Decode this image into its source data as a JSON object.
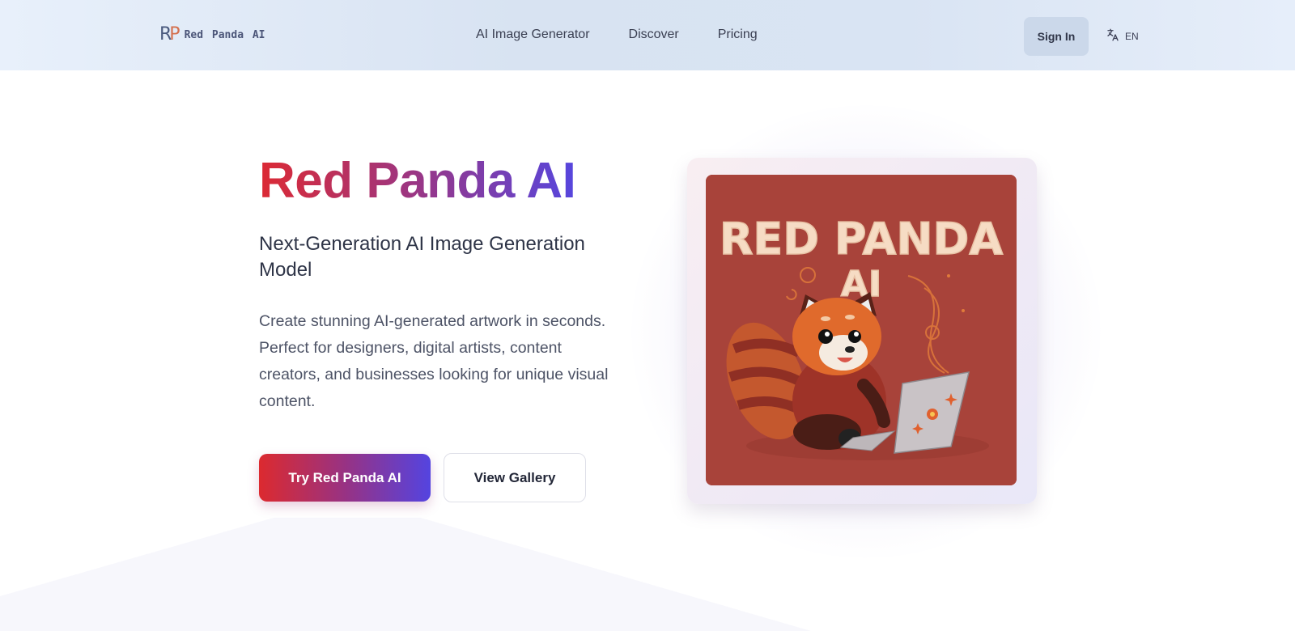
{
  "header": {
    "logo_mark_r": "R",
    "logo_mark_p": "P",
    "logo_text": "Red Panda AI",
    "nav": [
      {
        "label": "AI Image Generator"
      },
      {
        "label": "Discover"
      },
      {
        "label": "Pricing"
      }
    ],
    "signin_label": "Sign In",
    "language_icon": "translate-icon",
    "language_label": "EN"
  },
  "hero": {
    "title": "Red Panda AI",
    "subtitle": "Next-Generation AI Image Generation Model",
    "description": "Create stunning AI-generated artwork in seconds. Perfect for designers, digital artists, content creators, and businesses looking for unique visual content.",
    "primary_button": "Try Red Panda AI",
    "secondary_button": "View Gallery"
  },
  "showcase": {
    "image_text_line1": "RED PANDA",
    "image_text_line2": "AI",
    "image_description": "Illustration of a red panda using a laptop"
  },
  "colors": {
    "gradient_start": "#dc2a34",
    "gradient_mid": "#a0357d",
    "gradient_end": "#5646de",
    "art_background": "#a8433a"
  }
}
